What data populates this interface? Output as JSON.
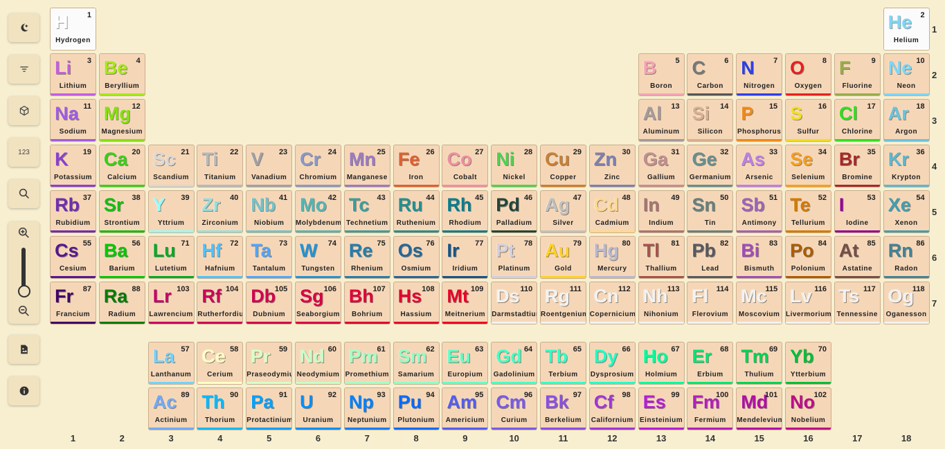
{
  "sidebar": {
    "buttons": [
      {
        "name": "theme-toggle-button",
        "icon": "moon-sparkle-icon"
      },
      {
        "name": "filter-button",
        "icon": "filter-icon"
      },
      {
        "name": "3d-view-button",
        "icon": "cube-icon"
      },
      {
        "name": "number-mode-button",
        "icon": "number-icon",
        "label": "123"
      },
      {
        "name": "search-button",
        "icon": "search-icon"
      },
      {
        "name": "export-image-button",
        "icon": "image-file-icon"
      },
      {
        "name": "info-button",
        "icon": "info-icon"
      }
    ],
    "zoom": {
      "in_icon": "zoom-in-icon",
      "out_icon": "zoom-out-icon",
      "level": 0
    }
  },
  "period_labels": [
    "1",
    "2",
    "3",
    "4",
    "5",
    "6",
    "7"
  ],
  "group_labels": [
    "1",
    "2",
    "3",
    "4",
    "5",
    "6",
    "7",
    "8",
    "9",
    "10",
    "11",
    "12",
    "13",
    "14",
    "15",
    "16",
    "17",
    "18"
  ],
  "elements": [
    {
      "n": 1,
      "s": "H",
      "name": "Hydrogen",
      "c": "#ffffff",
      "bar": "#ffffff",
      "white": true
    },
    {
      "n": 2,
      "s": "He",
      "name": "Helium",
      "c": "#7fd6f6",
      "bar": "#ffffff",
      "white": true
    },
    {
      "n": 3,
      "s": "Li",
      "name": "Lithium",
      "c": "#c45ee0",
      "bar": "#c45ee0"
    },
    {
      "n": 4,
      "s": "Be",
      "name": "Beryllium",
      "c": "#a6e81a",
      "bar": "#a6e81a"
    },
    {
      "n": 5,
      "s": "B",
      "name": "Boron",
      "c": "#f5a3b5",
      "bar": "#f5a3b5"
    },
    {
      "n": 6,
      "s": "C",
      "name": "Carbon",
      "c": "#777777",
      "bar": "#555555"
    },
    {
      "n": 7,
      "s": "N",
      "name": "Nitrogen",
      "c": "#2f3fe6",
      "bar": "#2f3fe6"
    },
    {
      "n": 8,
      "s": "O",
      "name": "Oxygen",
      "c": "#e62020",
      "bar": "#e62020"
    },
    {
      "n": 9,
      "s": "F",
      "name": "Fluorine",
      "c": "#9aac4b",
      "bar": "#9aac4b"
    },
    {
      "n": 10,
      "s": "Ne",
      "name": "Neon",
      "c": "#7fd6f6",
      "bar": "#7fd6f6"
    },
    {
      "n": 11,
      "s": "Na",
      "name": "Sodium",
      "c": "#a15ce0",
      "bar": "#a15ce0"
    },
    {
      "n": 12,
      "s": "Mg",
      "name": "Magnesium",
      "c": "#88e012",
      "bar": "#88e012"
    },
    {
      "n": 13,
      "s": "Al",
      "name": "Aluminum",
      "c": "#a69b9b",
      "bar": "#a69b9b"
    },
    {
      "n": 14,
      "s": "Si",
      "name": "Silicon",
      "c": "#d8b090",
      "bar": "#d8b090"
    },
    {
      "n": 15,
      "s": "P",
      "name": "Phosphorus",
      "c": "#f08a1a",
      "bar": "#f08a1a"
    },
    {
      "n": 16,
      "s": "S",
      "name": "Sulfur",
      "c": "#f0e020",
      "bar": "#f0e020"
    },
    {
      "n": 17,
      "s": "Cl",
      "name": "Chlorine",
      "c": "#2ee020",
      "bar": "#2ee020"
    },
    {
      "n": 18,
      "s": "Ar",
      "name": "Argon",
      "c": "#6ac4e0",
      "bar": "#6ac4e0"
    },
    {
      "n": 19,
      "s": "K",
      "name": "Potassium",
      "c": "#8a3fd0",
      "bar": "#8a3fd0"
    },
    {
      "n": 20,
      "s": "Ca",
      "name": "Calcium",
      "c": "#38d018",
      "bar": "#38d018"
    },
    {
      "n": 21,
      "s": "Sc",
      "name": "Scandium",
      "c": "#d8d8d8",
      "bar": "#d8d8d8"
    },
    {
      "n": 22,
      "s": "Ti",
      "name": "Titanium",
      "c": "#b8b8bc",
      "bar": "#b8b8bc"
    },
    {
      "n": 23,
      "s": "V",
      "name": "Vanadium",
      "c": "#a0a0a8",
      "bar": "#a0a0a8"
    },
    {
      "n": 24,
      "s": "Cr",
      "name": "Chromium",
      "c": "#8a99c4",
      "bar": "#8a99c4"
    },
    {
      "n": 25,
      "s": "Mn",
      "name": "Manganese",
      "c": "#9c7ac4",
      "bar": "#9c7ac4"
    },
    {
      "n": 26,
      "s": "Fe",
      "name": "Iron",
      "c": "#e06030",
      "bar": "#e06030"
    },
    {
      "n": 27,
      "s": "Co",
      "name": "Cobalt",
      "c": "#ef8fa0",
      "bar": "#ef8fa0"
    },
    {
      "n": 28,
      "s": "Ni",
      "name": "Nickel",
      "c": "#50d050",
      "bar": "#50d050"
    },
    {
      "n": 29,
      "s": "Cu",
      "name": "Copper",
      "c": "#c88033",
      "bar": "#c88033"
    },
    {
      "n": 30,
      "s": "Zn",
      "name": "Zinc",
      "c": "#7d80b0",
      "bar": "#7d80b0"
    },
    {
      "n": 31,
      "s": "Ga",
      "name": "Gallium",
      "c": "#c28f8f",
      "bar": "#c28f8f"
    },
    {
      "n": 32,
      "s": "Ge",
      "name": "Germanium",
      "c": "#668f8f",
      "bar": "#668f8f"
    },
    {
      "n": 33,
      "s": "As",
      "name": "Arsenic",
      "c": "#bd80e3",
      "bar": "#bd80e3"
    },
    {
      "n": 34,
      "s": "Se",
      "name": "Selenium",
      "c": "#f5a020",
      "bar": "#f5a020"
    },
    {
      "n": 35,
      "s": "Br",
      "name": "Bromine",
      "c": "#a62929",
      "bar": "#a62929"
    },
    {
      "n": 36,
      "s": "Kr",
      "name": "Krypton",
      "c": "#5cb8d1",
      "bar": "#5cb8d1"
    },
    {
      "n": 37,
      "s": "Rb",
      "name": "Rubidium",
      "c": "#702eb0",
      "bar": "#702eb0"
    },
    {
      "n": 38,
      "s": "Sr",
      "name": "Strontium",
      "c": "#12c012",
      "bar": "#12c012"
    },
    {
      "n": 39,
      "s": "Y",
      "name": "Yttrium",
      "c": "#94ffff",
      "bar": "#94ffff"
    },
    {
      "n": 40,
      "s": "Zr",
      "name": "Zirconium",
      "c": "#94e0e0",
      "bar": "#94e0e0"
    },
    {
      "n": 41,
      "s": "Nb",
      "name": "Niobium",
      "c": "#73c2c9",
      "bar": "#73c2c9"
    },
    {
      "n": 42,
      "s": "Mo",
      "name": "Molybdenum",
      "c": "#54b5b5",
      "bar": "#54b5b5"
    },
    {
      "n": 43,
      "s": "Tc",
      "name": "Technetium",
      "c": "#3b9e9e",
      "bar": "#3b9e9e"
    },
    {
      "n": 44,
      "s": "Ru",
      "name": "Ruthenium",
      "c": "#248f8f",
      "bar": "#248f8f"
    },
    {
      "n": 45,
      "s": "Rh",
      "name": "Rhodium",
      "c": "#0a7d8c",
      "bar": "#0a7d8c"
    },
    {
      "n": 46,
      "s": "Pd",
      "name": "Palladium",
      "c": "#22453a",
      "bar": "#22453a"
    },
    {
      "n": 47,
      "s": "Ag",
      "name": "Silver",
      "c": "#c0c0c0",
      "bar": "#c0c0c0"
    },
    {
      "n": 48,
      "s": "Cd",
      "name": "Cadmium",
      "c": "#ffd98f",
      "bar": "#ffd98f"
    },
    {
      "n": 49,
      "s": "In",
      "name": "Indium",
      "c": "#a67573",
      "bar": "#a67573"
    },
    {
      "n": 50,
      "s": "Sn",
      "name": "Tin",
      "c": "#668080",
      "bar": "#668080"
    },
    {
      "n": 51,
      "s": "Sb",
      "name": "Antimony",
      "c": "#9e63b5",
      "bar": "#9e63b5"
    },
    {
      "n": 52,
      "s": "Te",
      "name": "Tellurium",
      "c": "#d47a00",
      "bar": "#d47a00"
    },
    {
      "n": 53,
      "s": "I",
      "name": "Iodine",
      "c": "#940094",
      "bar": "#940094"
    },
    {
      "n": 54,
      "s": "Xe",
      "name": "Xenon",
      "c": "#429eb0",
      "bar": "#429eb0"
    },
    {
      "n": 55,
      "s": "Cs",
      "name": "Cesium",
      "c": "#57178f",
      "bar": "#57178f"
    },
    {
      "n": 56,
      "s": "Ba",
      "name": "Barium",
      "c": "#00c900",
      "bar": "#00c900"
    },
    {
      "n": 71,
      "s": "Lu",
      "name": "Lutetium",
      "c": "#00ab24",
      "bar": "#00ab24"
    },
    {
      "n": 72,
      "s": "Hf",
      "name": "Hafnium",
      "c": "#4dc2ff",
      "bar": "#4dc2ff"
    },
    {
      "n": 73,
      "s": "Ta",
      "name": "Tantalum",
      "c": "#4da6ff",
      "bar": "#4da6ff"
    },
    {
      "n": 74,
      "s": "W",
      "name": "Tungsten",
      "c": "#2194d6",
      "bar": "#2194d6"
    },
    {
      "n": 75,
      "s": "Re",
      "name": "Rhenium",
      "c": "#267dab",
      "bar": "#267dab"
    },
    {
      "n": 76,
      "s": "Os",
      "name": "Osmium",
      "c": "#266696",
      "bar": "#266696"
    },
    {
      "n": 77,
      "s": "Ir",
      "name": "Iridium",
      "c": "#175487",
      "bar": "#175487"
    },
    {
      "n": 78,
      "s": "Pt",
      "name": "Platinum",
      "c": "#d0d0e0",
      "bar": "#d0d0e0"
    },
    {
      "n": 79,
      "s": "Au",
      "name": "Gold",
      "c": "#ffd123",
      "bar": "#ffd123"
    },
    {
      "n": 80,
      "s": "Hg",
      "name": "Mercury",
      "c": "#b8b8d0",
      "bar": "#b8b8d0"
    },
    {
      "n": 81,
      "s": "Tl",
      "name": "Thallium",
      "c": "#a6544d",
      "bar": "#a6544d"
    },
    {
      "n": 82,
      "s": "Pb",
      "name": "Lead",
      "c": "#575961",
      "bar": "#575961"
    },
    {
      "n": 83,
      "s": "Bi",
      "name": "Bismuth",
      "c": "#9e4fb5",
      "bar": "#9e4fb5"
    },
    {
      "n": 84,
      "s": "Po",
      "name": "Polonium",
      "c": "#ab5c00",
      "bar": "#ab5c00"
    },
    {
      "n": 85,
      "s": "At",
      "name": "Astatine",
      "c": "#754f45",
      "bar": "#754f45"
    },
    {
      "n": 86,
      "s": "Rn",
      "name": "Radon",
      "c": "#428296",
      "bar": "#428296"
    },
    {
      "n": 87,
      "s": "Fr",
      "name": "Francium",
      "c": "#420066",
      "bar": "#420066"
    },
    {
      "n": 88,
      "s": "Ra",
      "name": "Radium",
      "c": "#007d00",
      "bar": "#007d00"
    },
    {
      "n": 103,
      "s": "Lr",
      "name": "Lawrencium",
      "c": "#c70066",
      "bar": "#c70066"
    },
    {
      "n": 104,
      "s": "Rf",
      "name": "Rutherfordium",
      "c": "#cc0059",
      "bar": "#cc0059"
    },
    {
      "n": 105,
      "s": "Db",
      "name": "Dubnium",
      "c": "#d1004f",
      "bar": "#d1004f"
    },
    {
      "n": 106,
      "s": "Sg",
      "name": "Seaborgium",
      "c": "#d90045",
      "bar": "#d90045"
    },
    {
      "n": 107,
      "s": "Bh",
      "name": "Bohrium",
      "c": "#e00038",
      "bar": "#e00038"
    },
    {
      "n": 108,
      "s": "Hs",
      "name": "Hassium",
      "c": "#e6002e",
      "bar": "#e6002e"
    },
    {
      "n": 109,
      "s": "Mt",
      "name": "Meitnerium",
      "c": "#eb0026",
      "bar": "#eb0026"
    },
    {
      "n": 110,
      "s": "Ds",
      "name": "Darmstadtium",
      "c": "#f2f2f2",
      "bar": "#f2f2f2"
    },
    {
      "n": 111,
      "s": "Rg",
      "name": "Roentgenium",
      "c": "#f2f2f2",
      "bar": "#f2f2f2"
    },
    {
      "n": 112,
      "s": "Cn",
      "name": "Copernicium",
      "c": "#f2f2f2",
      "bar": "#f2f2f2"
    },
    {
      "n": 113,
      "s": "Nh",
      "name": "Nihonium",
      "c": "#f2f2f2",
      "bar": "#f2f2f2"
    },
    {
      "n": 114,
      "s": "Fl",
      "name": "Flerovium",
      "c": "#f2f2f2",
      "bar": "#f2f2f2"
    },
    {
      "n": 115,
      "s": "Mc",
      "name": "Moscovium",
      "c": "#f2f2f2",
      "bar": "#f2f2f2"
    },
    {
      "n": 116,
      "s": "Lv",
      "name": "Livermorium",
      "c": "#f2f2f2",
      "bar": "#f2f2f2"
    },
    {
      "n": 117,
      "s": "Ts",
      "name": "Tennessine",
      "c": "#f2f2f2",
      "bar": "#f2f2f2"
    },
    {
      "n": 118,
      "s": "Og",
      "name": "Oganesson",
      "c": "#f2f2f2",
      "bar": "#f2f2f2"
    },
    {
      "n": 57,
      "s": "La",
      "name": "Lanthanum",
      "c": "#70d4ff",
      "bar": "#70d4ff"
    },
    {
      "n": 58,
      "s": "Ce",
      "name": "Cerium",
      "c": "#ffffc7",
      "bar": "#ffffc7"
    },
    {
      "n": 59,
      "s": "Pr",
      "name": "Praseodymium",
      "c": "#d9ffc7",
      "bar": "#d9ffc7"
    },
    {
      "n": 60,
      "s": "Nd",
      "name": "Neodymium",
      "c": "#c7ffc7",
      "bar": "#c7ffc7"
    },
    {
      "n": 61,
      "s": "Pm",
      "name": "Promethium",
      "c": "#a3ffc7",
      "bar": "#a3ffc7"
    },
    {
      "n": 62,
      "s": "Sm",
      "name": "Samarium",
      "c": "#8fffc7",
      "bar": "#8fffc7"
    },
    {
      "n": 63,
      "s": "Eu",
      "name": "Europium",
      "c": "#61ffc7",
      "bar": "#61ffc7"
    },
    {
      "n": 64,
      "s": "Gd",
      "name": "Gadolinium",
      "c": "#45ffc7",
      "bar": "#45ffc7"
    },
    {
      "n": 65,
      "s": "Tb",
      "name": "Terbium",
      "c": "#30ffc7",
      "bar": "#30ffc7"
    },
    {
      "n": 66,
      "s": "Dy",
      "name": "Dysprosium",
      "c": "#1fffc7",
      "bar": "#1fffc7"
    },
    {
      "n": 67,
      "s": "Ho",
      "name": "Holmium",
      "c": "#00ff9c",
      "bar": "#00ff9c"
    },
    {
      "n": 68,
      "s": "Er",
      "name": "Erbium",
      "c": "#00e675",
      "bar": "#00e675"
    },
    {
      "n": 69,
      "s": "Tm",
      "name": "Thulium",
      "c": "#00d452",
      "bar": "#00d452"
    },
    {
      "n": 70,
      "s": "Yb",
      "name": "Ytterbium",
      "c": "#00bf38",
      "bar": "#00bf38"
    },
    {
      "n": 89,
      "s": "Ac",
      "name": "Actinium",
      "c": "#70abfa",
      "bar": "#70abfa"
    },
    {
      "n": 90,
      "s": "Th",
      "name": "Thorium",
      "c": "#00baff",
      "bar": "#00baff"
    },
    {
      "n": 91,
      "s": "Pa",
      "name": "Protactinium",
      "c": "#00a1ff",
      "bar": "#00a1ff"
    },
    {
      "n": 92,
      "s": "U",
      "name": "Uranium",
      "c": "#008fff",
      "bar": "#008fff"
    },
    {
      "n": 93,
      "s": "Np",
      "name": "Neptunium",
      "c": "#0080ff",
      "bar": "#0080ff"
    },
    {
      "n": 94,
      "s": "Pu",
      "name": "Plutonium",
      "c": "#006bff",
      "bar": "#006bff"
    },
    {
      "n": 95,
      "s": "Am",
      "name": "Americium",
      "c": "#545cf2",
      "bar": "#545cf2"
    },
    {
      "n": 96,
      "s": "Cm",
      "name": "Curium",
      "c": "#785ce3",
      "bar": "#785ce3"
    },
    {
      "n": 97,
      "s": "Bk",
      "name": "Berkelium",
      "c": "#8a4fe3",
      "bar": "#8a4fe3"
    },
    {
      "n": 98,
      "s": "Cf",
      "name": "Californium",
      "c": "#a136d4",
      "bar": "#a136d4"
    },
    {
      "n": 99,
      "s": "Es",
      "name": "Einsteinium",
      "c": "#b31fd4",
      "bar": "#b31fd4"
    },
    {
      "n": 100,
      "s": "Fm",
      "name": "Fermium",
      "c": "#b31fba",
      "bar": "#b31fba"
    },
    {
      "n": 101,
      "s": "Md",
      "name": "Mendelevium",
      "c": "#b30da6",
      "bar": "#b30da6"
    },
    {
      "n": 102,
      "s": "No",
      "name": "Nobelium",
      "c": "#bd0d87",
      "bar": "#bd0d87"
    }
  ]
}
